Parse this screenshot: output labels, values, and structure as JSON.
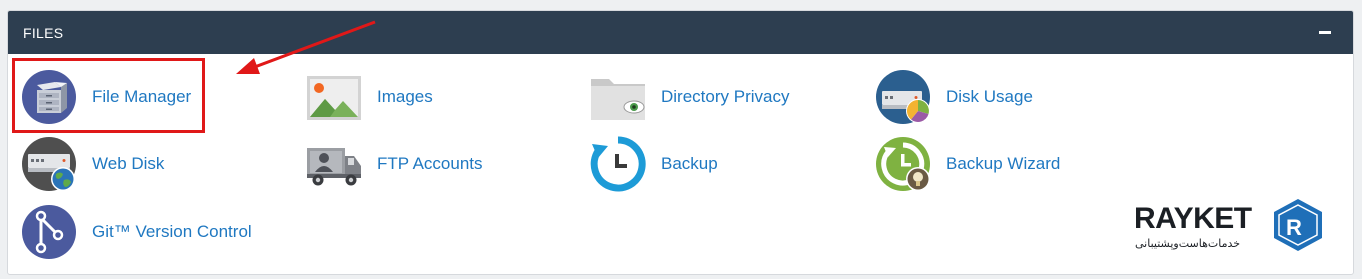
{
  "section": {
    "title": "FILES"
  },
  "items": [
    {
      "label": "File Manager",
      "icon": "file-manager-icon"
    },
    {
      "label": "Images",
      "icon": "images-icon"
    },
    {
      "label": "Directory Privacy",
      "icon": "directory-privacy-icon"
    },
    {
      "label": "Disk Usage",
      "icon": "disk-usage-icon"
    },
    {
      "label": "Web Disk",
      "icon": "web-disk-icon"
    },
    {
      "label": "FTP Accounts",
      "icon": "ftp-accounts-icon"
    },
    {
      "label": "Backup",
      "icon": "backup-icon"
    },
    {
      "label": "Backup Wizard",
      "icon": "backup-wizard-icon"
    },
    {
      "label": "Git™ Version Control",
      "icon": "git-version-control-icon"
    }
  ],
  "logo": {
    "name": "RAYKET",
    "tagline": "خدمات‌هاست‌وپشتیبانی"
  },
  "colors": {
    "header": "#2d3e50",
    "link": "#1f78c1",
    "annotation": "#e01818"
  }
}
